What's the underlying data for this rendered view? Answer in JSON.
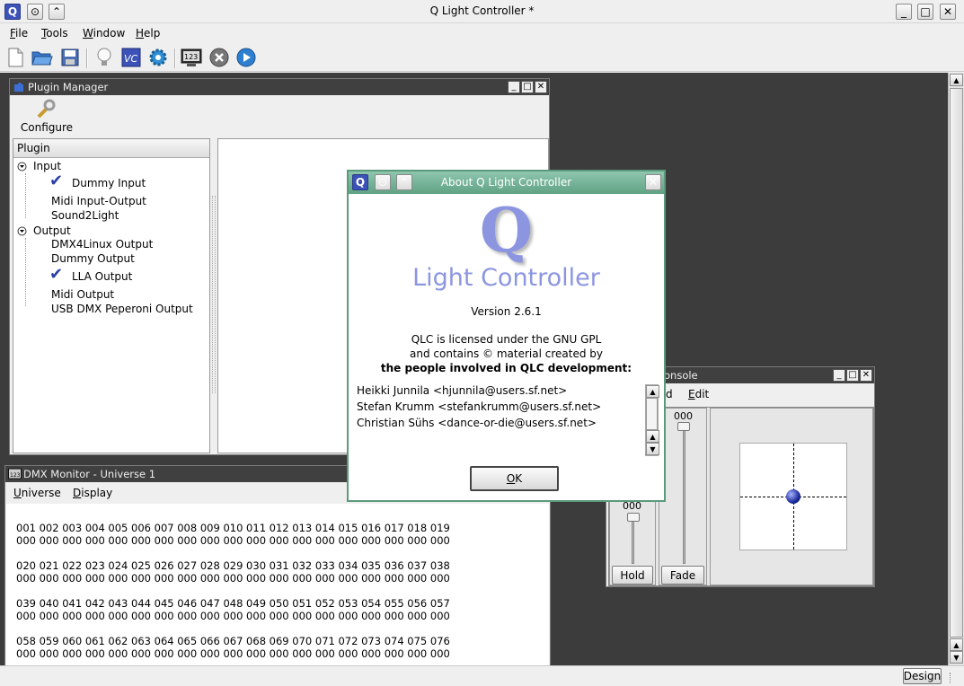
{
  "app": {
    "title": "Q Light Controller *",
    "logo_letter": "Q",
    "win_min": "_",
    "win_max": "□",
    "win_close": "✕"
  },
  "menu": [
    {
      "label": "File"
    },
    {
      "label": "Tools"
    },
    {
      "label": "Window"
    },
    {
      "label": "Help"
    }
  ],
  "toolbar": {
    "icons": [
      "new-icon",
      "open-icon",
      "save-icon",
      "bulb-icon",
      "vc-icon",
      "gear-icon",
      "monitor-icon",
      "stop-icon",
      "play-icon"
    ],
    "monitor_text": "123"
  },
  "plugin_manager": {
    "title": "Plugin Manager",
    "configure_label": "Configure",
    "header": "Plugin",
    "input_group": "Input",
    "input_items": [
      "Dummy Input",
      "Midi Input-Output",
      "Sound2Light"
    ],
    "output_group": "Output",
    "output_items": [
      "DMX4Linux Output",
      "Dummy Output",
      "LLA Output",
      "Midi Output",
      "USB DMX Peperoni Output"
    ]
  },
  "dmx_monitor": {
    "title": "DMX Monitor - Universe 1",
    "menu_universe": "Universe",
    "menu_display": "Display",
    "rows": [
      {
        "channels": "001 002 003 004 005 006 007 008 009 010 011 012 013 014 015 016 017 018 019",
        "values": "000 000 000 000 000 000 000 000 000 000 000 000 000 000 000 000 000 000 000"
      },
      {
        "channels": "020 021 022 023 024 025 026 027 028 029 030 031 032 033 034 035 036 037 038",
        "values": "000 000 000 000 000 000 000 000 000 000 000 000 000 000 000 000 000 000 000"
      },
      {
        "channels": "039 040 041 042 043 044 045 046 047 048 049 050 051 052 053 054 055 056 057",
        "values": "000 000 000 000 000 000 000 000 000 000 000 000 000 000 000 000 000 000 000"
      },
      {
        "channels": "058 059 060 061 062 063 064 065 066 067 068 069 070 071 072 073 074 075 076",
        "values": "000 000 000 000 000 000 000 000 000 000 000 000 000 000 000 000 000 000 000"
      }
    ]
  },
  "console": {
    "title": "onsole",
    "menu_d": "d",
    "menu_edit": "Edit",
    "fader1_value": "000",
    "fader2_value": "000",
    "hold_label": "Hold",
    "fade_label": "Fade"
  },
  "about": {
    "title": "About Q Light Controller",
    "logo_q": "Q",
    "logo_text": "Light Controller",
    "version": "Version 2.6.1",
    "license1": "QLC is licensed under the GNU GPL",
    "license2": "and contains © material created by",
    "license3": "the people involved in QLC development:",
    "authors": [
      "Heikki Junnila <hjunnila@users.sf.net>",
      "Stefan Krumm <stefankrumm@users.sf.net>",
      "Christian Sühs <dance-or-die@users.sf.net>"
    ],
    "ok_label": "OK"
  },
  "status": {
    "mode_label": "Design"
  },
  "colors": {
    "workspace": "#3c3c3c",
    "mdi_title": "#404040",
    "about_title": "#5fa284",
    "accent": "#3c52b8"
  }
}
